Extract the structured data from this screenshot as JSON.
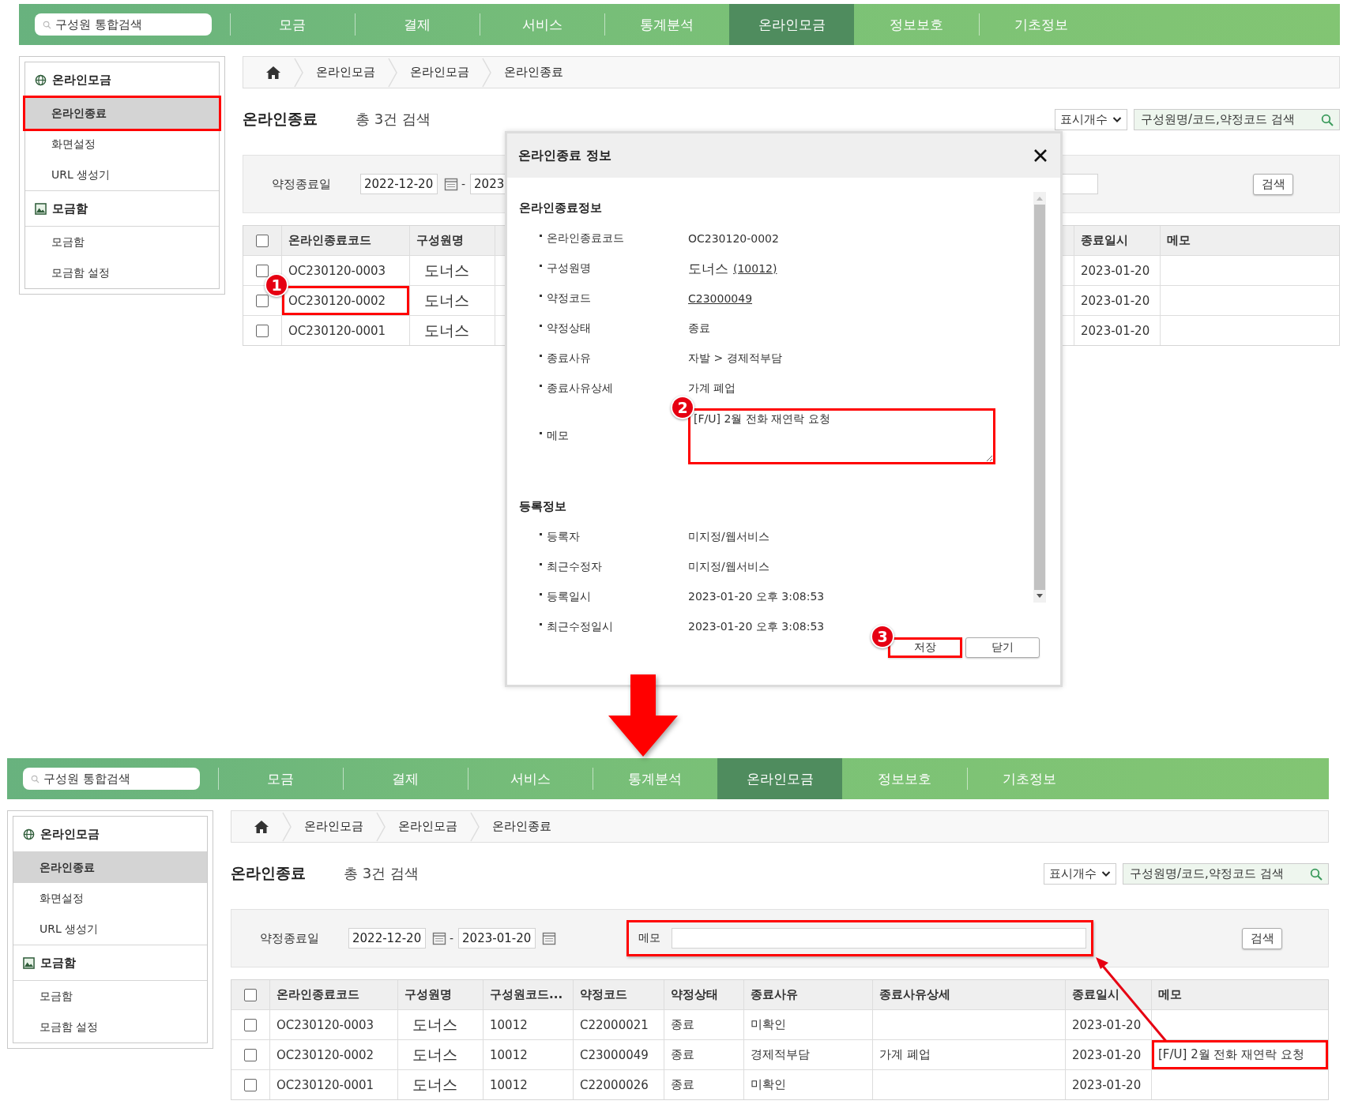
{
  "screens": [
    {
      "nav": {
        "search_placeholder": "구성원 통합검색",
        "menu": [
          {
            "label": "모금",
            "selected": false
          },
          {
            "label": "결제",
            "selected": false
          },
          {
            "label": "서비스",
            "selected": false
          },
          {
            "label": "통계분석",
            "selected": false
          },
          {
            "label": "온라인모금",
            "selected": true
          },
          {
            "label": "정보보호",
            "selected": false
          },
          {
            "label": "기초정보",
            "selected": false
          }
        ]
      },
      "sidebar": {
        "groups": [
          {
            "title": "온라인모금",
            "items": [
              {
                "label": "온라인종료",
                "selected": true,
                "highlighted": true
              },
              {
                "label": "화면설정",
                "selected": false,
                "highlighted": false
              },
              {
                "label": "URL 생성기",
                "selected": false,
                "highlighted": false
              }
            ]
          },
          {
            "title": "모금함",
            "items": [
              {
                "label": "모금함",
                "selected": false,
                "highlighted": false
              },
              {
                "label": "모금함 설정",
                "selected": false,
                "highlighted": false
              }
            ]
          }
        ]
      },
      "breadcrumb": [
        "온라인모금",
        "온라인모금",
        "온라인종료"
      ],
      "title": "온라인종료",
      "result_count": "총 3건 검색",
      "page_size_select": "표시개수",
      "search_placeholder": "구성원명/코드,약정코드 검색",
      "filter": {
        "label": "약정종료일",
        "date_from": "2022-12-20",
        "separator": "-",
        "date_to": "2023",
        "memo": {
          "highlighted": false
        },
        "button": "검색"
      },
      "table": {
        "all_checked": false,
        "column_groups": [
          [
            "온라인종료코드",
            "구성원명"
          ],
          [
            "종료일시",
            "메모"
          ]
        ],
        "rows": [
          {
            "checked": false,
            "cell_groups": [
              [
                {
                  "text": "OC230120-0003",
                  "highlighted": false
                },
                {
                  "text": "도너스",
                  "highlighted": false
                }
              ],
              [
                {
                  "text": "2023-01-20",
                  "highlighted": false
                },
                {
                  "highlighted": false
                }
              ]
            ]
          },
          {
            "checked": false,
            "cell_groups": [
              [
                {
                  "text": "OC230120-0002",
                  "highlighted": true,
                  "marker": "1"
                },
                {
                  "text": "도너스",
                  "highlighted": false
                }
              ],
              [
                {
                  "text": "2023-01-20",
                  "highlighted": false
                },
                {
                  "highlighted": false
                }
              ]
            ]
          },
          {
            "checked": false,
            "cell_groups": [
              [
                {
                  "text": "OC230120-0001",
                  "highlighted": false
                },
                {
                  "text": "도너스",
                  "highlighted": false
                }
              ],
              [
                {
                  "text": "2023-01-20",
                  "highlighted": false
                },
                {
                  "highlighted": false
                }
              ]
            ]
          }
        ]
      }
    },
    {
      "nav": {
        "search_placeholder": "구성원 통합검색",
        "menu": [
          {
            "label": "모금",
            "selected": false
          },
          {
            "label": "결제",
            "selected": false
          },
          {
            "label": "서비스",
            "selected": false
          },
          {
            "label": "통계분석",
            "selected": false
          },
          {
            "label": "온라인모금",
            "selected": true
          },
          {
            "label": "정보보호",
            "selected": false
          },
          {
            "label": "기초정보",
            "selected": false
          }
        ]
      },
      "sidebar": {
        "groups": [
          {
            "title": "온라인모금",
            "items": [
              {
                "label": "온라인종료",
                "selected": true,
                "highlighted": false
              },
              {
                "label": "화면설정",
                "selected": false,
                "highlighted": false
              },
              {
                "label": "URL 생성기",
                "selected": false,
                "highlighted": false
              }
            ]
          },
          {
            "title": "모금함",
            "items": [
              {
                "label": "모금함",
                "selected": false,
                "highlighted": false
              },
              {
                "label": "모금함 설정",
                "selected": false,
                "highlighted": false
              }
            ]
          }
        ]
      },
      "breadcrumb": [
        "온라인모금",
        "온라인모금",
        "온라인종료"
      ],
      "title": "온라인종료",
      "result_count": "총 3건 검색",
      "page_size_select": "표시개수",
      "search_placeholder": "구성원명/코드,약정코드 검색",
      "filter": {
        "label": "약정종료일",
        "date_from": "2022-12-20",
        "separator": "-",
        "date_to": "2023-01-20",
        "date_to_calendar": true,
        "memo": {
          "label": "메모",
          "highlighted": true
        },
        "button": "검색"
      },
      "table": {
        "all_checked": false,
        "column_groups": [
          [
            "온라인종료코드",
            "구성원명",
            "구성원코드...",
            "약정코드",
            "약정상태",
            "종료사유",
            "종료사유상세",
            "종료일시",
            "메모"
          ]
        ],
        "rows": [
          {
            "checked": false,
            "cell_groups": [
              [
                {
                  "text": "OC230120-0003",
                  "highlighted": false
                },
                {
                  "text": "도너스",
                  "highlighted": false
                },
                {
                  "text": "10012",
                  "highlighted": false
                },
                {
                  "text": "C22000021",
                  "highlighted": false
                },
                {
                  "text": "종료",
                  "highlighted": false
                },
                {
                  "text": "미확인",
                  "highlighted": false
                },
                {
                  "highlighted": false
                },
                {
                  "text": "2023-01-20",
                  "highlighted": false
                },
                {
                  "highlighted": false
                }
              ]
            ]
          },
          {
            "checked": false,
            "cell_groups": [
              [
                {
                  "text": "OC230120-0002",
                  "highlighted": false
                },
                {
                  "text": "도너스",
                  "highlighted": false
                },
                {
                  "text": "10012",
                  "highlighted": false
                },
                {
                  "text": "C23000049",
                  "highlighted": false
                },
                {
                  "text": "종료",
                  "highlighted": false
                },
                {
                  "text": "경제적부담",
                  "highlighted": false
                },
                {
                  "text": "가계 폐업",
                  "highlighted": false
                },
                {
                  "text": "2023-01-20",
                  "highlighted": false
                },
                {
                  "text": "[F/U] 2월 전화 재연락 요청",
                  "highlighted": true
                }
              ]
            ]
          },
          {
            "checked": false,
            "cell_groups": [
              [
                {
                  "text": "OC230120-0001",
                  "highlighted": false
                },
                {
                  "text": "도너스",
                  "highlighted": false
                },
                {
                  "text": "10012",
                  "highlighted": false
                },
                {
                  "text": "C22000026",
                  "highlighted": false
                },
                {
                  "text": "종료",
                  "highlighted": false
                },
                {
                  "text": "미확인",
                  "highlighted": false
                },
                {
                  "highlighted": false
                },
                {
                  "text": "2023-01-20",
                  "highlighted": false
                },
                {
                  "highlighted": false
                }
              ]
            ]
          }
        ]
      },
      "callout_arrow": true
    }
  ],
  "dialog": {
    "title": "온라인종료 정보",
    "sections": [
      {
        "title": "온라인종료정보",
        "fields": [
          {
            "kind": "text",
            "label": "온라인종료코드",
            "value": "OC230120-0002"
          },
          {
            "kind": "text",
            "label": "구성원명",
            "value": "도너스",
            "link": "(10012)"
          },
          {
            "kind": "text",
            "label": "약정코드",
            "link": "C23000049"
          },
          {
            "kind": "text",
            "label": "약정상태",
            "value": "종료"
          },
          {
            "kind": "text",
            "label": "종료사유",
            "value": "자발 > 경제적부담"
          },
          {
            "kind": "text",
            "label": "종료사유상세",
            "value": "가계 폐업"
          },
          {
            "kind": "textarea",
            "label": "메모",
            "value": "[F/U] 2월 전화 재연락 요청",
            "highlighted": true,
            "marker": "2"
          }
        ]
      },
      {
        "title": "등록정보",
        "fields": [
          {
            "kind": "text",
            "label": "등록자",
            "value": "미지정/웹서비스"
          },
          {
            "kind": "text",
            "label": "최근수정자",
            "value": "미지정/웹서비스"
          },
          {
            "kind": "text",
            "label": "등록일시",
            "value": "2023-01-20 오후 3:08:53"
          },
          {
            "kind": "text",
            "label": "최근수정일시",
            "value": "2023-01-20 오후 3:08:53"
          }
        ]
      }
    ],
    "buttons": [
      {
        "label": "저장",
        "highlighted": true,
        "marker": "3"
      },
      {
        "label": "닫기",
        "highlighted": false
      }
    ]
  },
  "transition_arrow": true
}
